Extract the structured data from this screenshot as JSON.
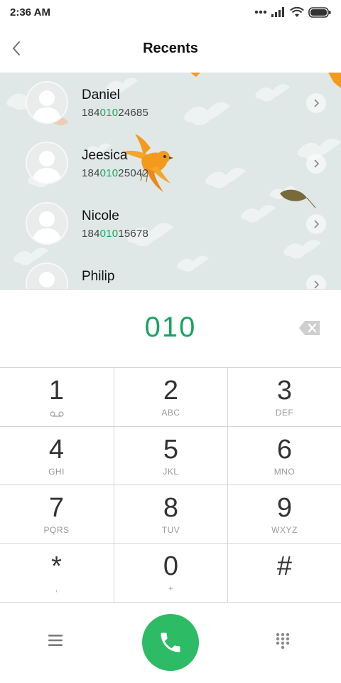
{
  "status_bar": {
    "time": "2:36 AM"
  },
  "header": {
    "title": "Recents"
  },
  "recents": [
    {
      "name": "Daniel",
      "number_prefix": "184",
      "number_match": "010",
      "number_suffix": "24685"
    },
    {
      "name": "Jeesica",
      "number_prefix": "184",
      "number_match": "010",
      "number_suffix": "25042"
    },
    {
      "name": "Nicole",
      "number_prefix": "184",
      "number_match": "010",
      "number_suffix": "15678"
    },
    {
      "name": "Philip",
      "number_prefix": "",
      "number_match": "",
      "number_suffix": ""
    }
  ],
  "dial_input": {
    "value": "010"
  },
  "keypad": [
    {
      "digit": "1",
      "sub": ""
    },
    {
      "digit": "2",
      "sub": "ABC"
    },
    {
      "digit": "3",
      "sub": "DEF"
    },
    {
      "digit": "4",
      "sub": "GHI"
    },
    {
      "digit": "5",
      "sub": "JKL"
    },
    {
      "digit": "6",
      "sub": "MNO"
    },
    {
      "digit": "7",
      "sub": "PQRS"
    },
    {
      "digit": "8",
      "sub": "TUV"
    },
    {
      "digit": "9",
      "sub": "WXYZ"
    },
    {
      "digit": "*",
      "sub": ","
    },
    {
      "digit": "0",
      "sub": "+"
    },
    {
      "digit": "#",
      "sub": ""
    }
  ],
  "icons": {
    "back": "chevron-left-icon",
    "backspace": "backspace-icon",
    "voicemail": "voicemail-icon",
    "menu": "menu-icon",
    "call": "phone-icon",
    "dialpad": "dialpad-icon"
  },
  "colors": {
    "accent": "#19a363",
    "call_button": "#2dbb65",
    "bird": "#f39a1e"
  }
}
